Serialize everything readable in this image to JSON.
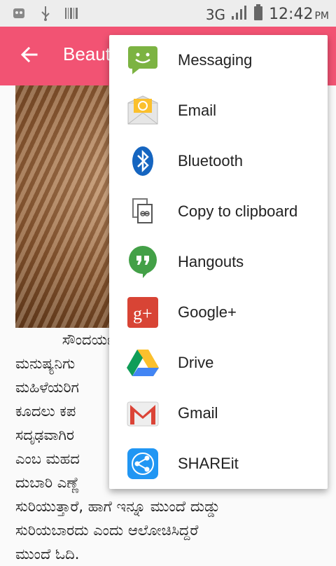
{
  "status": {
    "network": "3G",
    "time": "12:42",
    "ampm": "PM"
  },
  "appbar": {
    "title": "Beauty Tips"
  },
  "article": {
    "lines": [
      "          ಸೌಂದರ್ಯ",
      "ಮನುಷ್ಯನಿಗು",
      "ಮಹಿಳೆಯರಿಗ",
      "ಕೂದಲು ಕಪ",
      "ಸದೃಢವಾಗಿರ",
      "ಎಂಬ ಮಹದ",
      "ದುಬಾರಿ ಎಣ್ಣೆ",
      "ಸುರಿಯುತ್ತಾರೆ, ಹಾಗೆ ಇನ್ನೂ ಮುಂದೆ ದುಡ್ಡು",
      "ಸುರಿಯಬಾರದು ಎಂದು ಆಲೋಚಿಸಿದ್ದರೆ",
      "ಮುಂದೆ ಓದಿ."
    ]
  },
  "share_menu": {
    "items": [
      {
        "label": "Messaging",
        "icon": "messaging-icon"
      },
      {
        "label": "Email",
        "icon": "email-icon"
      },
      {
        "label": "Bluetooth",
        "icon": "bluetooth-icon"
      },
      {
        "label": "Copy to clipboard",
        "icon": "clipboard-icon"
      },
      {
        "label": "Hangouts",
        "icon": "hangouts-icon"
      },
      {
        "label": "Google+",
        "icon": "google-plus-icon"
      },
      {
        "label": "Drive",
        "icon": "drive-icon"
      },
      {
        "label": "Gmail",
        "icon": "gmail-icon"
      },
      {
        "label": "SHAREit",
        "icon": "shareit-icon"
      }
    ]
  },
  "colors": {
    "appbar": "#f25373",
    "statusbar": "#ededed"
  }
}
